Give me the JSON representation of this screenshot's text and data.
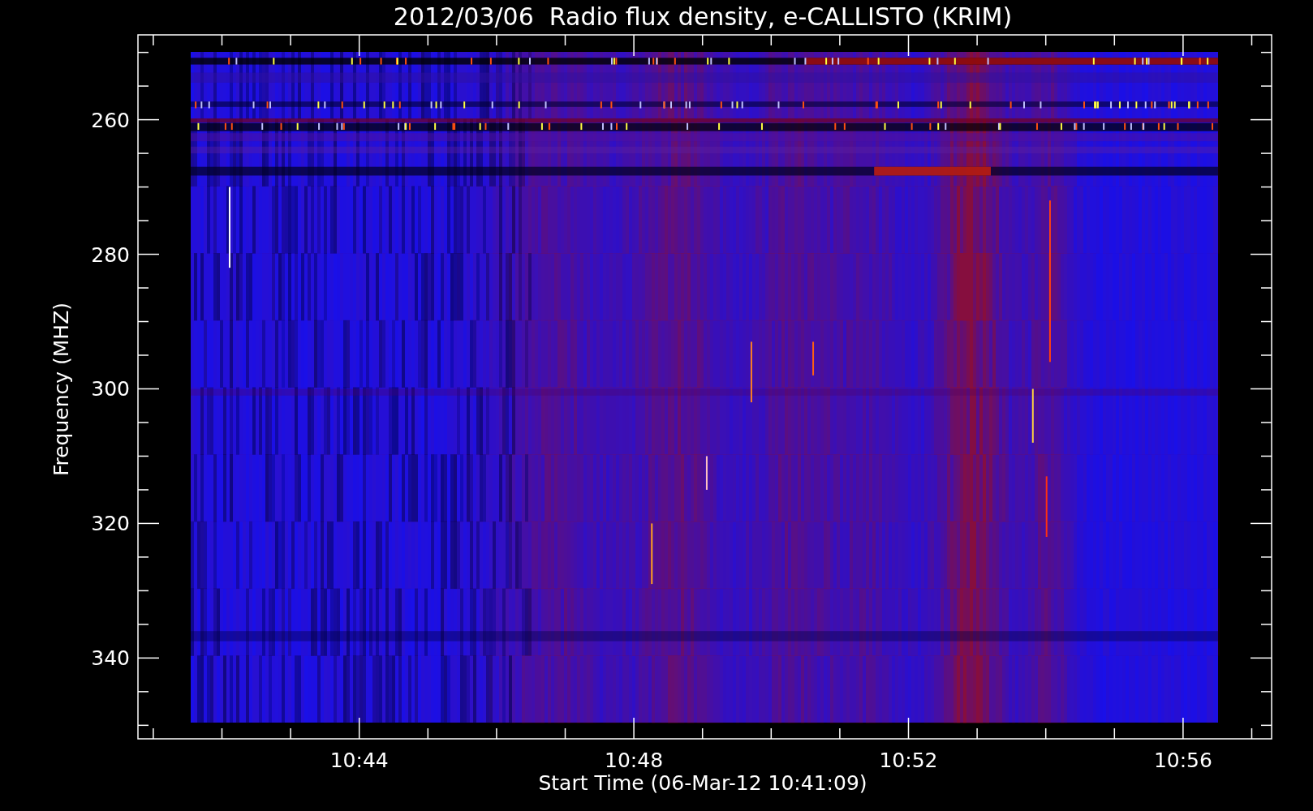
{
  "plot": {
    "title": "2012/03/06  Radio flux density, e-CALLISTO (KRIM)",
    "y_axis": {
      "label": "Frequency (MHZ)",
      "ticks": [
        "260",
        "280",
        "300",
        "320",
        "340"
      ]
    },
    "x_axis": {
      "label": "Start Time (06-Mar-12 10:41:09)",
      "ticks": [
        "10:44",
        "10:48",
        "10:52",
        "10:56"
      ]
    }
  }
}
